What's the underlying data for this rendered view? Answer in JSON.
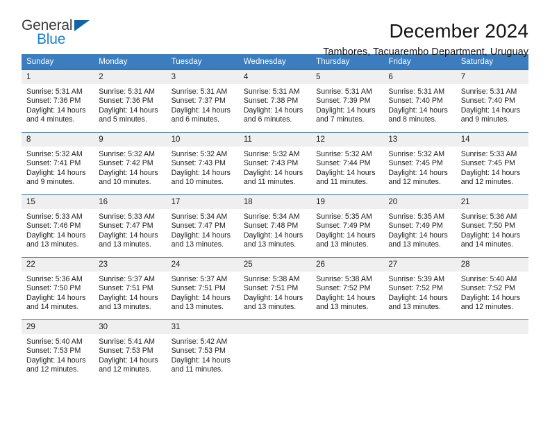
{
  "logo": {
    "word_one": "General",
    "word_two": "Blue",
    "triangle_color": "#1464a5",
    "blue_color": "#1b7fd4"
  },
  "header": {
    "title": "December 2024",
    "subtitle": "Tambores, Tacuarembo Department, Uruguay"
  },
  "theme": {
    "header_bg": "#3b7dbf",
    "daynum_bg": "#efefef",
    "rule_color": "#2e6da4"
  },
  "weekday_headers": [
    "Sunday",
    "Monday",
    "Tuesday",
    "Wednesday",
    "Thursday",
    "Friday",
    "Saturday"
  ],
  "weeks": [
    {
      "days": [
        {
          "num": "1",
          "sunrise": "Sunrise: 5:31 AM",
          "sunset": "Sunset: 7:36 PM",
          "daylight1": "Daylight: 14 hours",
          "daylight2": "and 4 minutes."
        },
        {
          "num": "2",
          "sunrise": "Sunrise: 5:31 AM",
          "sunset": "Sunset: 7:36 PM",
          "daylight1": "Daylight: 14 hours",
          "daylight2": "and 5 minutes."
        },
        {
          "num": "3",
          "sunrise": "Sunrise: 5:31 AM",
          "sunset": "Sunset: 7:37 PM",
          "daylight1": "Daylight: 14 hours",
          "daylight2": "and 6 minutes."
        },
        {
          "num": "4",
          "sunrise": "Sunrise: 5:31 AM",
          "sunset": "Sunset: 7:38 PM",
          "daylight1": "Daylight: 14 hours",
          "daylight2": "and 6 minutes."
        },
        {
          "num": "5",
          "sunrise": "Sunrise: 5:31 AM",
          "sunset": "Sunset: 7:39 PM",
          "daylight1": "Daylight: 14 hours",
          "daylight2": "and 7 minutes."
        },
        {
          "num": "6",
          "sunrise": "Sunrise: 5:31 AM",
          "sunset": "Sunset: 7:40 PM",
          "daylight1": "Daylight: 14 hours",
          "daylight2": "and 8 minutes."
        },
        {
          "num": "7",
          "sunrise": "Sunrise: 5:31 AM",
          "sunset": "Sunset: 7:40 PM",
          "daylight1": "Daylight: 14 hours",
          "daylight2": "and 9 minutes."
        }
      ]
    },
    {
      "days": [
        {
          "num": "8",
          "sunrise": "Sunrise: 5:32 AM",
          "sunset": "Sunset: 7:41 PM",
          "daylight1": "Daylight: 14 hours",
          "daylight2": "and 9 minutes."
        },
        {
          "num": "9",
          "sunrise": "Sunrise: 5:32 AM",
          "sunset": "Sunset: 7:42 PM",
          "daylight1": "Daylight: 14 hours",
          "daylight2": "and 10 minutes."
        },
        {
          "num": "10",
          "sunrise": "Sunrise: 5:32 AM",
          "sunset": "Sunset: 7:43 PM",
          "daylight1": "Daylight: 14 hours",
          "daylight2": "and 10 minutes."
        },
        {
          "num": "11",
          "sunrise": "Sunrise: 5:32 AM",
          "sunset": "Sunset: 7:43 PM",
          "daylight1": "Daylight: 14 hours",
          "daylight2": "and 11 minutes."
        },
        {
          "num": "12",
          "sunrise": "Sunrise: 5:32 AM",
          "sunset": "Sunset: 7:44 PM",
          "daylight1": "Daylight: 14 hours",
          "daylight2": "and 11 minutes."
        },
        {
          "num": "13",
          "sunrise": "Sunrise: 5:32 AM",
          "sunset": "Sunset: 7:45 PM",
          "daylight1": "Daylight: 14 hours",
          "daylight2": "and 12 minutes."
        },
        {
          "num": "14",
          "sunrise": "Sunrise: 5:33 AM",
          "sunset": "Sunset: 7:45 PM",
          "daylight1": "Daylight: 14 hours",
          "daylight2": "and 12 minutes."
        }
      ]
    },
    {
      "days": [
        {
          "num": "15",
          "sunrise": "Sunrise: 5:33 AM",
          "sunset": "Sunset: 7:46 PM",
          "daylight1": "Daylight: 14 hours",
          "daylight2": "and 13 minutes."
        },
        {
          "num": "16",
          "sunrise": "Sunrise: 5:33 AM",
          "sunset": "Sunset: 7:47 PM",
          "daylight1": "Daylight: 14 hours",
          "daylight2": "and 13 minutes."
        },
        {
          "num": "17",
          "sunrise": "Sunrise: 5:34 AM",
          "sunset": "Sunset: 7:47 PM",
          "daylight1": "Daylight: 14 hours",
          "daylight2": "and 13 minutes."
        },
        {
          "num": "18",
          "sunrise": "Sunrise: 5:34 AM",
          "sunset": "Sunset: 7:48 PM",
          "daylight1": "Daylight: 14 hours",
          "daylight2": "and 13 minutes."
        },
        {
          "num": "19",
          "sunrise": "Sunrise: 5:35 AM",
          "sunset": "Sunset: 7:49 PM",
          "daylight1": "Daylight: 14 hours",
          "daylight2": "and 13 minutes."
        },
        {
          "num": "20",
          "sunrise": "Sunrise: 5:35 AM",
          "sunset": "Sunset: 7:49 PM",
          "daylight1": "Daylight: 14 hours",
          "daylight2": "and 13 minutes."
        },
        {
          "num": "21",
          "sunrise": "Sunrise: 5:36 AM",
          "sunset": "Sunset: 7:50 PM",
          "daylight1": "Daylight: 14 hours",
          "daylight2": "and 14 minutes."
        }
      ]
    },
    {
      "days": [
        {
          "num": "22",
          "sunrise": "Sunrise: 5:36 AM",
          "sunset": "Sunset: 7:50 PM",
          "daylight1": "Daylight: 14 hours",
          "daylight2": "and 14 minutes."
        },
        {
          "num": "23",
          "sunrise": "Sunrise: 5:37 AM",
          "sunset": "Sunset: 7:51 PM",
          "daylight1": "Daylight: 14 hours",
          "daylight2": "and 13 minutes."
        },
        {
          "num": "24",
          "sunrise": "Sunrise: 5:37 AM",
          "sunset": "Sunset: 7:51 PM",
          "daylight1": "Daylight: 14 hours",
          "daylight2": "and 13 minutes."
        },
        {
          "num": "25",
          "sunrise": "Sunrise: 5:38 AM",
          "sunset": "Sunset: 7:51 PM",
          "daylight1": "Daylight: 14 hours",
          "daylight2": "and 13 minutes."
        },
        {
          "num": "26",
          "sunrise": "Sunrise: 5:38 AM",
          "sunset": "Sunset: 7:52 PM",
          "daylight1": "Daylight: 14 hours",
          "daylight2": "and 13 minutes."
        },
        {
          "num": "27",
          "sunrise": "Sunrise: 5:39 AM",
          "sunset": "Sunset: 7:52 PM",
          "daylight1": "Daylight: 14 hours",
          "daylight2": "and 13 minutes."
        },
        {
          "num": "28",
          "sunrise": "Sunrise: 5:40 AM",
          "sunset": "Sunset: 7:52 PM",
          "daylight1": "Daylight: 14 hours",
          "daylight2": "and 12 minutes."
        }
      ]
    },
    {
      "days": [
        {
          "num": "29",
          "sunrise": "Sunrise: 5:40 AM",
          "sunset": "Sunset: 7:53 PM",
          "daylight1": "Daylight: 14 hours",
          "daylight2": "and 12 minutes."
        },
        {
          "num": "30",
          "sunrise": "Sunrise: 5:41 AM",
          "sunset": "Sunset: 7:53 PM",
          "daylight1": "Daylight: 14 hours",
          "daylight2": "and 12 minutes."
        },
        {
          "num": "31",
          "sunrise": "Sunrise: 5:42 AM",
          "sunset": "Sunset: 7:53 PM",
          "daylight1": "Daylight: 14 hours",
          "daylight2": "and 11 minutes."
        },
        {
          "num": "",
          "sunrise": "",
          "sunset": "",
          "daylight1": "",
          "daylight2": ""
        },
        {
          "num": "",
          "sunrise": "",
          "sunset": "",
          "daylight1": "",
          "daylight2": ""
        },
        {
          "num": "",
          "sunrise": "",
          "sunset": "",
          "daylight1": "",
          "daylight2": ""
        },
        {
          "num": "",
          "sunrise": "",
          "sunset": "",
          "daylight1": "",
          "daylight2": ""
        }
      ]
    }
  ]
}
